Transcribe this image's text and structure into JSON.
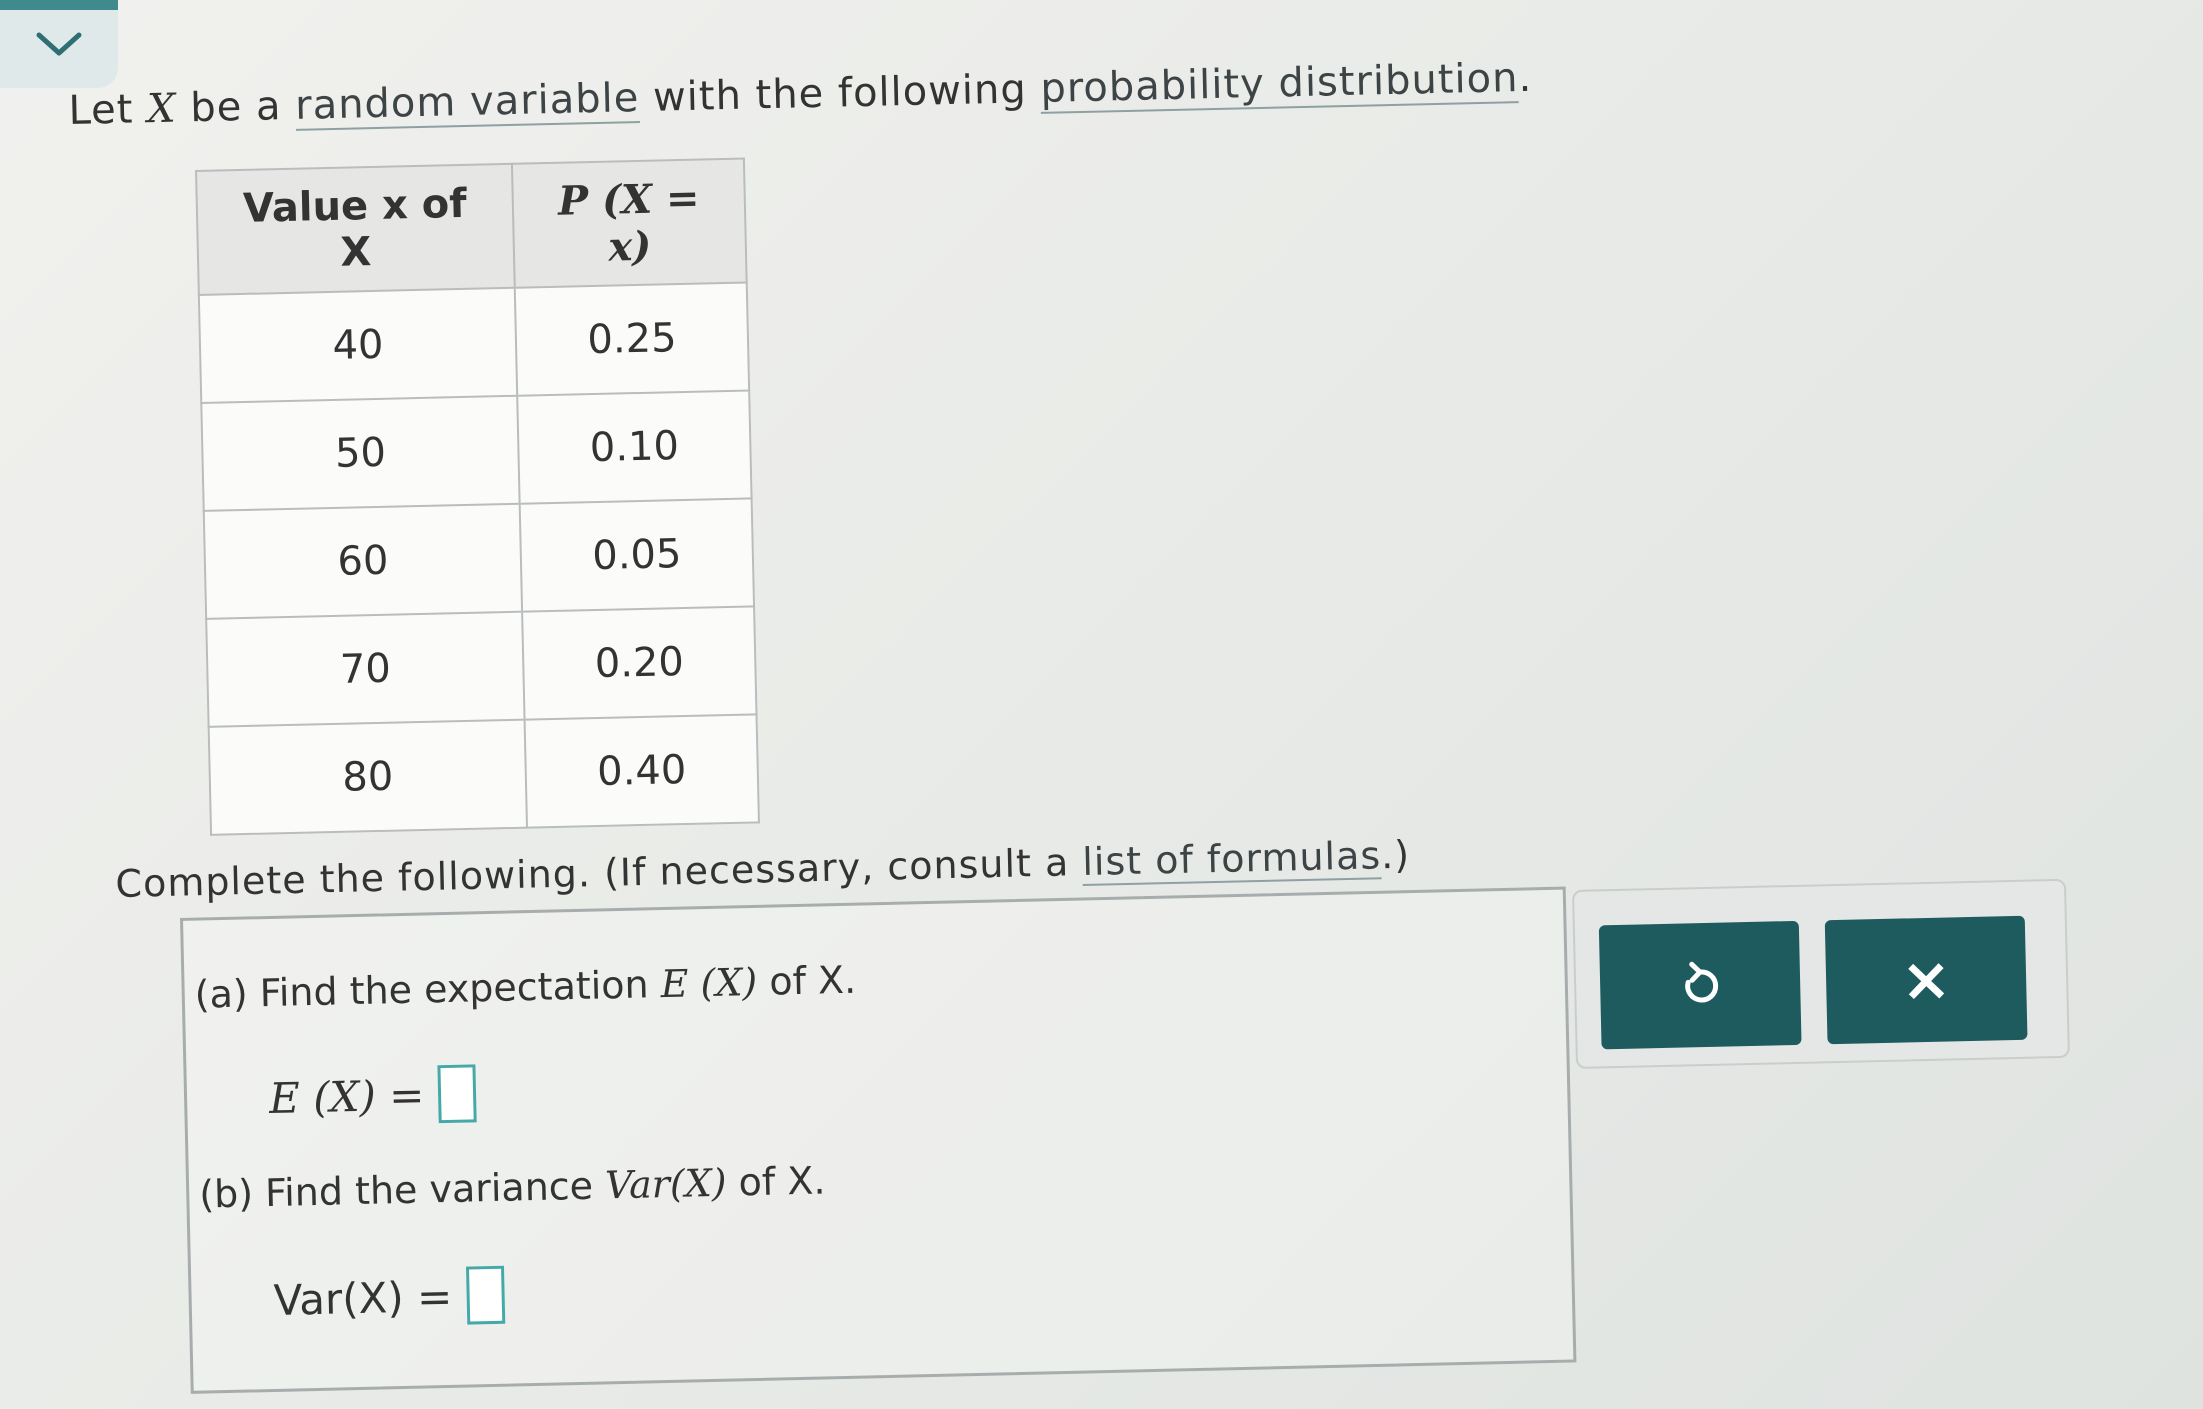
{
  "intro": {
    "prefix": "Let",
    "var": "X",
    "middle": "be a",
    "link_random": "random variable",
    "with": "with the following",
    "link_dist": "probability distribution",
    "period": "."
  },
  "table": {
    "header_value": "Value x of X",
    "header_prob": "P (X = x)",
    "rows": [
      {
        "value": "40",
        "prob": "0.25"
      },
      {
        "value": "50",
        "prob": "0.10"
      },
      {
        "value": "60",
        "prob": "0.05"
      },
      {
        "value": "70",
        "prob": "0.20"
      },
      {
        "value": "80",
        "prob": "0.40"
      }
    ]
  },
  "instructions": {
    "text": "Complete the following. (If necessary, consult a",
    "link": "list of formulas",
    "end": ".)"
  },
  "question_a": {
    "text": "(a) Find the expectation",
    "expr": "E (X)",
    "suffix": "of X.",
    "eq_label": "E (X) =",
    "input_value": ""
  },
  "question_b": {
    "text": "(b) Find the variance",
    "expr": "Var(X)",
    "suffix": "of X.",
    "eq_label": "Var(X) =",
    "input_value": ""
  },
  "buttons": {
    "undo_icon": "undo-icon",
    "close_icon": "close-icon",
    "close_glyph": "×"
  },
  "colors": {
    "accent": "#1e5b5f",
    "input_border": "#46a9a9",
    "tab": "#3f8a8d"
  }
}
